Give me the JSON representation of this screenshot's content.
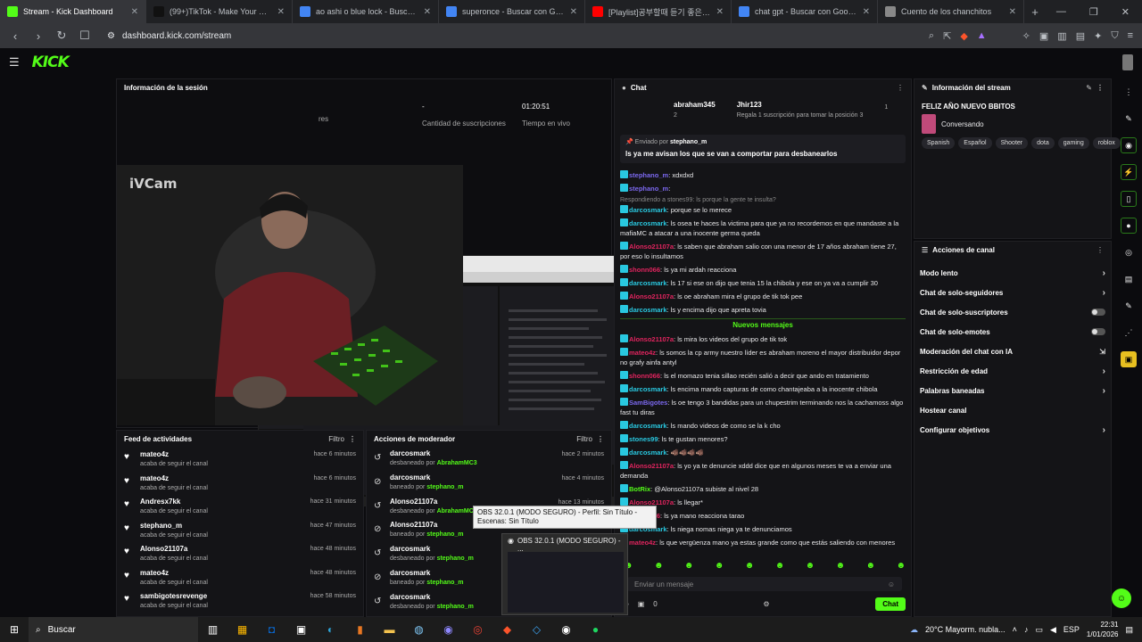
{
  "browser": {
    "tabs": [
      {
        "title": "Stream - Kick Dashboard",
        "active": true,
        "color": "#53fc18"
      },
      {
        "title": "(99+)TikTok - Make Your Day",
        "active": false,
        "color": "#111111"
      },
      {
        "title": "ao ashi o blue lock - Buscar con Goo",
        "active": false,
        "color": "#4285f4"
      },
      {
        "title": "superonce - Buscar con Google",
        "active": false,
        "color": "#4285f4"
      },
      {
        "title": "[Playlist]공부할때 듣기 좋은 지브리",
        "active": false,
        "color": "#ff0000"
      },
      {
        "title": "chat gpt - Buscar con Google",
        "active": false,
        "color": "#4285f4"
      },
      {
        "title": "Cuento de los chanchitos",
        "active": false,
        "color": "#888888"
      }
    ],
    "url": "dashboard.kick.com/stream"
  },
  "kick": {
    "logo": "KICK"
  },
  "session": {
    "title": "Información de la sesión",
    "stats": [
      {
        "value": "-",
        "label": "Cantidad de suscripciones"
      },
      {
        "value": "01:20:51",
        "label": "Tiempo en vivo"
      }
    ],
    "partial_label": "res",
    "cam_label": "iVCam"
  },
  "feed": {
    "title": "Feed de actividades",
    "filter": "Filtro",
    "items": [
      {
        "name": "mateo4z",
        "sub": "acaba de seguir el canal",
        "time": "hace 6 minutos"
      },
      {
        "name": "mateo4z",
        "sub": "acaba de seguir el canal",
        "time": "hace 6 minutos"
      },
      {
        "name": "Andresx7kk",
        "sub": "acaba de seguir el canal",
        "time": "hace 31 minutos"
      },
      {
        "name": "stephano_m",
        "sub": "acaba de seguir el canal",
        "time": "hace 47 minutos"
      },
      {
        "name": "Alonso21107a",
        "sub": "acaba de seguir el canal",
        "time": "hace 48 minutos"
      },
      {
        "name": "mateo4z",
        "sub": "acaba de seguir el canal",
        "time": "hace 48 minutos"
      },
      {
        "name": "sambigotesrevenge",
        "sub": "acaba de seguir el canal",
        "time": "hace 58 minutos"
      }
    ]
  },
  "mod": {
    "title": "Acciones de moderador",
    "filter": "Filtro",
    "items": [
      {
        "name": "darcosmark",
        "action": "desbaneado por",
        "by": "AbrahamMC3",
        "time": "hace 2 minutos",
        "icon": "undo"
      },
      {
        "name": "darcosmark",
        "action": "baneado por",
        "by": "stephano_m",
        "time": "hace 4 minutos",
        "icon": "ban"
      },
      {
        "name": "Alonso21107a",
        "action": "desbaneado por",
        "by": "AbrahamMC3",
        "time": "hace 13 minutos",
        "icon": "undo"
      },
      {
        "name": "Alonso21107a",
        "action": "baneado por",
        "by": "stephano_m",
        "time": "hace 14 minutos",
        "icon": "ban"
      },
      {
        "name": "darcosmark",
        "action": "desbaneado por",
        "by": "stephano_m",
        "time": "",
        "icon": "undo"
      },
      {
        "name": "darcosmark",
        "action": "baneado por",
        "by": "stephano_m",
        "time": "",
        "icon": "ban"
      },
      {
        "name": "darcosmark",
        "action": "desbaneado por",
        "by": "stephano_m",
        "time": "",
        "icon": "undo"
      }
    ]
  },
  "chat": {
    "title": "Chat",
    "leaders": [
      {
        "name": "abraham345",
        "count": "2"
      },
      {
        "name": "Jhir123",
        "count": "Regala 1 suscripción para tomar la posición 3"
      },
      {
        "name": "",
        "count": "1"
      }
    ],
    "pinned": {
      "by_label": "Enviado por",
      "by_user": "stephano_m",
      "message": "ls ya me avisan los que se van a comportar para desbanearlos"
    },
    "messages": [
      {
        "user": "stephano_m",
        "color": "#7b68ee",
        "text": "xdxdxd"
      },
      {
        "user": "stephano_m",
        "color": "#7b68ee",
        "text": ""
      },
      {
        "reply": "Respondiendo a stones99: ls porque la gente te insulta?",
        "user": "darcosmark",
        "color": "#29c8e0",
        "text": "porque se lo merece"
      },
      {
        "user": "darcosmark",
        "color": "#29c8e0",
        "text": "ls osea te haces la victima para que ya no recordemos en que mandaste a la mafiaMC a atacar a una inocente germa queda"
      },
      {
        "user": "Alonso21107a",
        "color": "#e0245e",
        "text": "ls saben que abraham salio con una menor de 17 años abraham tiene 27, por eso lo insultamos"
      },
      {
        "user": "shonn066",
        "color": "#e0245e",
        "text": "ls ya mi ardah reacciona"
      },
      {
        "user": "darcosmark",
        "color": "#29c8e0",
        "text": "ls 17 si ese on dijo que tenia 15 la chibola y ese on ya va a cumplir 30"
      },
      {
        "user": "Alonso21107a",
        "color": "#e0245e",
        "text": "ls oe abraham mira el grupo de tik tok pee"
      },
      {
        "user": "darcosmark",
        "color": "#29c8e0",
        "text": "ls y encima dijo que apreta tovia"
      }
    ],
    "new_label": "Nuevos mensajes",
    "messages2": [
      {
        "user": "Alonso21107a",
        "color": "#e0245e",
        "text": "ls mira los videos del grupo de tik tok"
      },
      {
        "user": "mateo4z",
        "color": "#e0245e",
        "text": "ls somos la cp army nuestro líder es abraham moreno el mayor distribuidor depor no grafy ainfa antyl"
      },
      {
        "user": "shonn066",
        "color": "#e0245e",
        "text": "ls el momazo tenia sillao recién salió a decir que ando en tratamiento"
      },
      {
        "user": "darcosmark",
        "color": "#29c8e0",
        "text": "ls encima mando capturas de como chantajeaba a la inocente chibola"
      },
      {
        "user": "SamBigotes",
        "color": "#7b68ee",
        "text": "ls oe tengo 3 bandidas para un chupestrim terminando nos la cachamoss algo fast tu diras"
      },
      {
        "user": "darcosmark",
        "color": "#29c8e0",
        "text": "ls mando videos de como se la k cho"
      },
      {
        "user": "stones99",
        "color": "#29c8e0",
        "text": "ls te gustan menores?"
      },
      {
        "user": "darcosmark",
        "color": "#29c8e0",
        "text": "🐗🐗🐗🐗"
      },
      {
        "user": "Alonso21107a",
        "color": "#e0245e",
        "text": "ls yo ya te denuncie xddd dice que en algunos meses te va a enviar una demanda"
      },
      {
        "user": "BotRix",
        "color": "#53fc18",
        "text": "@Alonso21107a subiste al nivel 28"
      },
      {
        "user": "Alonso21107a",
        "color": "#e0245e",
        "text": "ls llegar*"
      },
      {
        "user": "shonn066",
        "color": "#e0245e",
        "text": "ls ya mano reacciona tarao"
      },
      {
        "user": "darcosmark",
        "color": "#29c8e0",
        "text": "ls niega nomas niega ya te denunciamos"
      },
      {
        "user": "mateo4z",
        "color": "#e0245e",
        "text": "ls que vergüenza mano ya estas grande como que estás saliendo con menores"
      }
    ],
    "input_placeholder": "Enviar un mensaje",
    "infinity": "∞",
    "gift_count": "0",
    "send": "Chat"
  },
  "streaminfo": {
    "title": "Información del stream",
    "stream_title": "FELIZ AÑO NUEVO BBITOS",
    "category": "Conversando",
    "tags": [
      "Spanish",
      "Español",
      "Shooter",
      "dota",
      "gaming",
      "roblox"
    ]
  },
  "channel": {
    "title": "Acciones de canal",
    "items": [
      {
        "label": "Modo lento",
        "kind": "arrow"
      },
      {
        "label": "Chat de solo-seguidores",
        "kind": "arrow"
      },
      {
        "label": "Chat de solo-suscriptores",
        "kind": "toggle"
      },
      {
        "label": "Chat de solo-emotes",
        "kind": "toggle"
      },
      {
        "label": "Moderación del chat con IA",
        "kind": "ext"
      },
      {
        "label": "Restricción de edad",
        "kind": "arrow"
      },
      {
        "label": "Palabras baneadas",
        "kind": "arrow"
      },
      {
        "label": "Hostear canal",
        "kind": "none"
      },
      {
        "label": "Configurar objetivos",
        "kind": "arrow"
      }
    ]
  },
  "tooltip": "OBS 32.0.1 (MODO SEGURO) - Perfil: Sin Título - Escenas: Sin Título",
  "obs_title": "OBS 32.0.1 (MODO SEGURO) - ...",
  "taskbar": {
    "search": "Buscar",
    "weather": "20°C  Mayorm. nubla...",
    "lang": "ESP",
    "time": "22:31",
    "date": "1/01/2026"
  }
}
